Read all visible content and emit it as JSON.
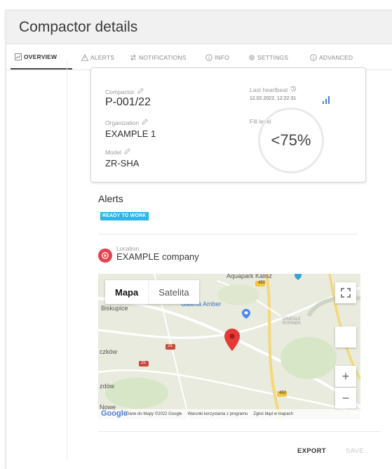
{
  "header": {
    "title": "Compactor details"
  },
  "tabs": [
    {
      "label": "OVERVIEW",
      "icon": "chart-icon"
    },
    {
      "label": "ALERTS",
      "icon": "warning-icon"
    },
    {
      "label": "NOTIFICATIONS",
      "icon": "arrows-icon"
    },
    {
      "label": "INFO",
      "icon": "info-icon"
    },
    {
      "label": "SETTINGS",
      "icon": "gear-icon"
    },
    {
      "label": "ADVANCED",
      "icon": "info-icon"
    }
  ],
  "details": {
    "compactor_label": "Compactor",
    "compactor_value": "P-001/22",
    "organization_label": "Organization",
    "organization_value": "EXAMPLE 1",
    "model_label": "Model",
    "model_value": "ZR-SHA",
    "heartbeat_label": "Last heartbeat",
    "heartbeat_value": "12.02.2022, 12:22:31",
    "fill_label": "Fill level",
    "fill_value": "<75%"
  },
  "alerts": {
    "title": "Alerts",
    "badge": "READY TO WORK"
  },
  "location": {
    "label": "Location",
    "value": "EXAMPLE company"
  },
  "map": {
    "map_type": "Mapa",
    "satellite": "Satelita",
    "places": [
      "Aquapark Kalisz",
      "Biskupice",
      "Galeria Amber",
      "OSIEDLE RYPINEK",
      "czków",
      "zdów",
      "Nowe"
    ],
    "roads": [
      "450",
      "25",
      "25",
      "450"
    ],
    "logo": "Google",
    "attribution": [
      "Dane do Mapy ©2022 Google",
      "Warunki korzystania z programu",
      "Zgłoś błąd w mapach"
    ],
    "zoom_in": "+",
    "zoom_out": "−"
  },
  "actions": {
    "export": "EXPORT",
    "save": "SAVE"
  },
  "colors": {
    "badge": "#29b6e8",
    "pin": "#e5424d",
    "signal": "#3b82d6"
  }
}
